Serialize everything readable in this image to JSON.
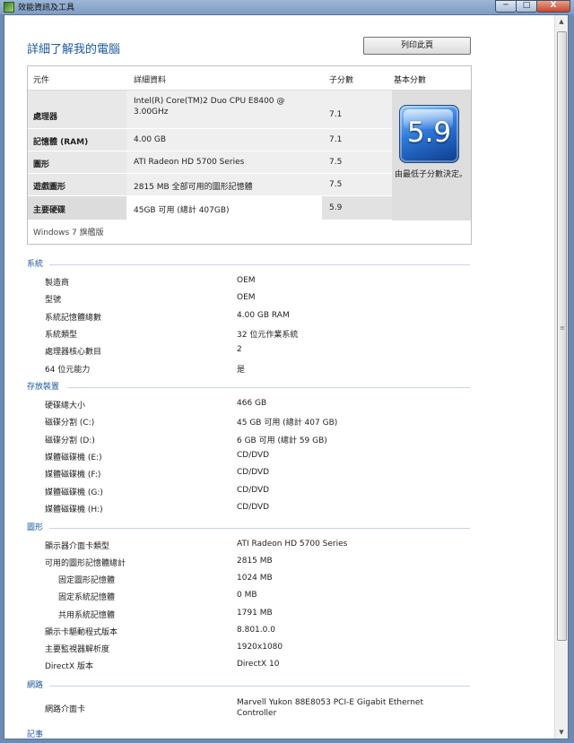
{
  "window": {
    "title": "效能資訊及工具",
    "min": "─",
    "max": "□",
    "close": "X"
  },
  "page": {
    "title": "詳細了解我的電腦",
    "print_button": "列印此頁"
  },
  "wei": {
    "headers": {
      "component": "元件",
      "details": "詳細資料",
      "subscore": "子分數",
      "base": "基本分數"
    },
    "rows": [
      {
        "component": "處理器",
        "details": "Intel(R) Core(TM)2 Duo CPU E8400 @ 3.00GHz",
        "subscore": "7.1"
      },
      {
        "component": "記憶體 (RAM)",
        "details": "4.00 GB",
        "subscore": "7.1"
      },
      {
        "component": "圖形",
        "details": "ATI Radeon HD 5700 Series",
        "subscore": "7.5"
      },
      {
        "component": "遊戲圖形",
        "details": "2815 MB 全部可用的圖形記憶體",
        "subscore": "7.5"
      },
      {
        "component": "主要硬碟",
        "details": "45GB 可用 (總計 407GB)",
        "subscore": "5.9"
      }
    ],
    "base_score": "5.9",
    "base_note": "由最低子分數決定。",
    "edition": "Windows 7 旗艦版"
  },
  "system": {
    "title": "系統",
    "items": [
      {
        "label": "製造商",
        "value": "OEM"
      },
      {
        "label": "型號",
        "value": "OEM"
      },
      {
        "label": "系統記憶體總數",
        "value": "4.00 GB RAM"
      },
      {
        "label": "系統類型",
        "value": "32 位元作業系統"
      },
      {
        "label": "處理器核心數目",
        "value": "2"
      },
      {
        "label": "64 位元能力",
        "value": "是"
      }
    ]
  },
  "storage": {
    "title": "存放裝置",
    "items": [
      {
        "label": "硬碟總大小",
        "value": "466 GB"
      },
      {
        "label": "磁碟分割 (C:)",
        "value": "45 GB 可用 (總計 407 GB)"
      },
      {
        "label": "磁碟分割 (D:)",
        "value": "6 GB 可用 (總計 59 GB)"
      },
      {
        "label": "媒體磁碟機 (E:)",
        "value": "CD/DVD"
      },
      {
        "label": "媒體磁碟機 (F:)",
        "value": "CD/DVD"
      },
      {
        "label": "媒體磁碟機 (G:)",
        "value": "CD/DVD"
      },
      {
        "label": "媒體磁碟機 (H:)",
        "value": "CD/DVD"
      }
    ]
  },
  "graphics": {
    "title": "圖形",
    "items": [
      {
        "label": "顯示器介面卡類型",
        "value": "ATI Radeon HD 5700 Series"
      },
      {
        "label": "可用的圖形記憶體總計",
        "value": "2815 MB"
      },
      {
        "label": "固定圖形記憶體",
        "value": "1024 MB"
      },
      {
        "label": "固定系統記憶體",
        "value": "0 MB"
      },
      {
        "label": "共用系統記憶體",
        "value": "1791 MB"
      },
      {
        "label": "顯示卡驅動程式版本",
        "value": "8.801.0.0"
      },
      {
        "label": "主要監視器解析度",
        "value": "1920x1080"
      },
      {
        "label": "DirectX 版本",
        "value": "DirectX 10"
      }
    ]
  },
  "network": {
    "title": "網路",
    "items": [
      {
        "label": "網路介面卡",
        "value": "Marvell Yukon 88E8053 PCI-E Gigabit Ethernet Controller"
      }
    ]
  },
  "next_section": {
    "title": "記事"
  },
  "scrollbar": {
    "up": "▲",
    "down": "▼",
    "grip": "≡"
  }
}
